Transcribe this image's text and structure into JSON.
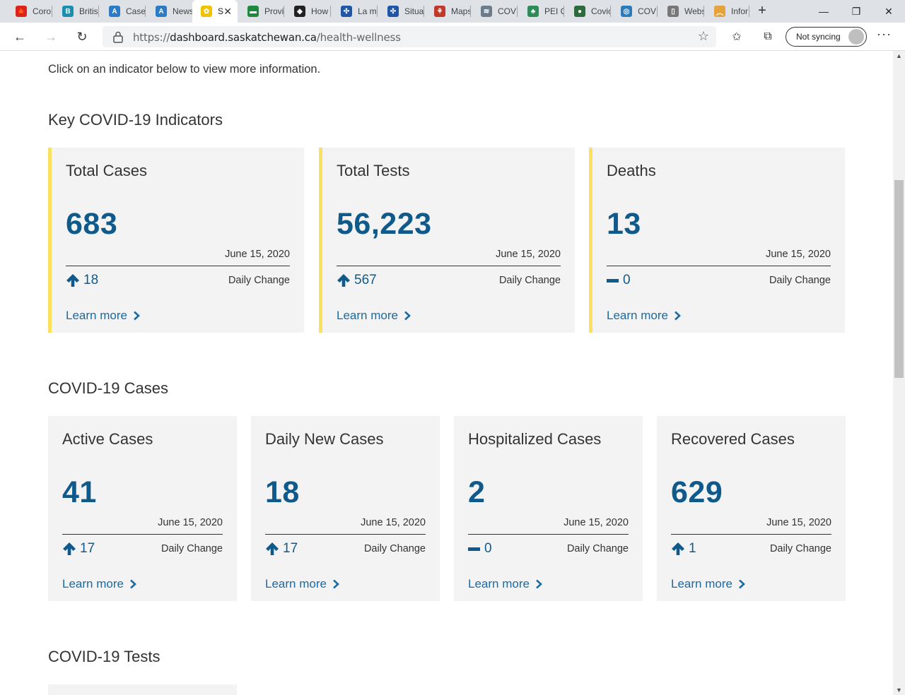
{
  "browser": {
    "tabs": [
      {
        "label": "Coro",
        "color": "#d9261c",
        "glyph": "🍁"
      },
      {
        "label": "Britis",
        "color": "#1a8fb0",
        "glyph": "B"
      },
      {
        "label": "Cases",
        "color": "#2a7cc7",
        "glyph": "A"
      },
      {
        "label": "News",
        "color": "#2a7cc7",
        "glyph": "A"
      },
      {
        "label": "S",
        "color": "#f2c200",
        "glyph": "✿",
        "active": true
      },
      {
        "label": "Provi",
        "color": "#1e8a3e",
        "glyph": "▬"
      },
      {
        "label": "How",
        "color": "#222222",
        "glyph": "◆"
      },
      {
        "label": "La m",
        "color": "#1f56a8",
        "glyph": "✣"
      },
      {
        "label": "Situa",
        "color": "#1f56a8",
        "glyph": "✣"
      },
      {
        "label": "Maps",
        "color": "#c0392b",
        "glyph": "⚘"
      },
      {
        "label": "COVI",
        "color": "#6a7b8c",
        "glyph": "≋"
      },
      {
        "label": "PEI C",
        "color": "#2e8b57",
        "glyph": "♣"
      },
      {
        "label": "Covic",
        "color": "#2d6b3c",
        "glyph": "●"
      },
      {
        "label": "COVI",
        "color": "#2c7ab8",
        "glyph": "◎"
      },
      {
        "label": "Webs",
        "color": "#777777",
        "glyph": "▯"
      },
      {
        "label": "Infor",
        "color": "#e6a23c",
        "glyph": "︵"
      }
    ],
    "url_prefix": "https://",
    "url_host": "dashboard.saskatchewan.ca",
    "url_path": "/health-wellness",
    "sync_label": "Not syncing"
  },
  "page": {
    "intro": "Click on an indicator below to view more information.",
    "sections": {
      "key_title": "Key COVID-19 Indicators",
      "cases_title": "COVID-19 Cases",
      "tests_title": "COVID-19 Tests"
    },
    "key_cards": [
      {
        "title": "Total Cases",
        "value": "683",
        "date": "June 15, 2020",
        "change": "18",
        "trend": "up",
        "daily_label": "Daily Change",
        "learn": "Learn more"
      },
      {
        "title": "Total Tests",
        "value": "56,223",
        "date": "June 15, 2020",
        "change": "567",
        "trend": "up",
        "daily_label": "Daily Change",
        "learn": "Learn more"
      },
      {
        "title": "Deaths",
        "value": "13",
        "date": "June 15, 2020",
        "change": "0",
        "trend": "flat",
        "daily_label": "Daily Change",
        "learn": "Learn more"
      }
    ],
    "case_cards": [
      {
        "title": "Active Cases",
        "value": "41",
        "date": "June 15, 2020",
        "change": "17",
        "trend": "up",
        "daily_label": "Daily Change",
        "learn": "Learn more"
      },
      {
        "title": "Daily New Cases",
        "value": "18",
        "date": "June 15, 2020",
        "change": "17",
        "trend": "up",
        "daily_label": "Daily Change",
        "learn": "Learn more"
      },
      {
        "title": "Hospitalized Cases",
        "value": "2",
        "date": "June 15, 2020",
        "change": "0",
        "trend": "flat",
        "daily_label": "Daily Change",
        "learn": "Learn more"
      },
      {
        "title": "Recovered Cases",
        "value": "629",
        "date": "June 15, 2020",
        "change": "1",
        "trend": "up",
        "daily_label": "Daily Change",
        "learn": "Learn more"
      }
    ]
  }
}
